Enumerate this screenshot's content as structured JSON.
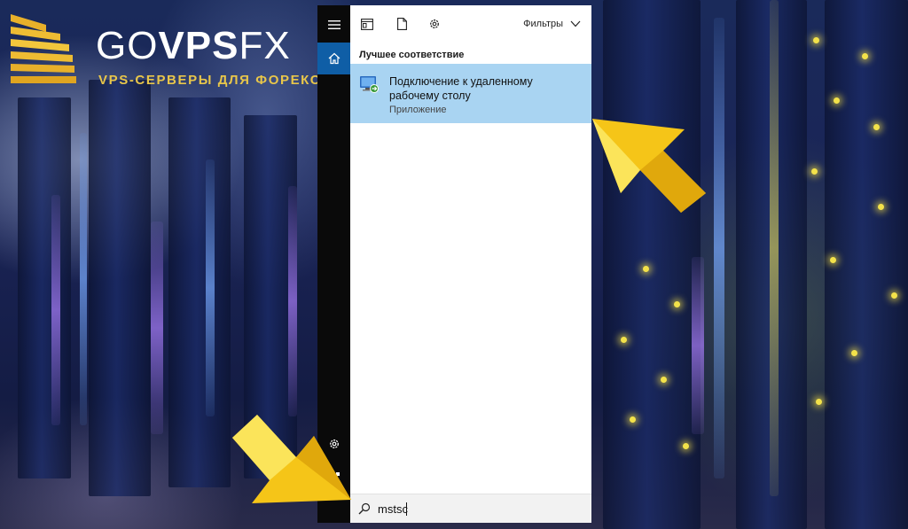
{
  "logo": {
    "go": "GO",
    "vps": "VPS",
    "fx": "FX",
    "tagline": "VPS-СЕРВЕРЫ ДЛЯ ФОРЕКС"
  },
  "start_rail": {
    "items": [
      {
        "icon": "hamburger-menu-icon"
      },
      {
        "icon": "home-icon"
      },
      {
        "icon": "gear-icon"
      },
      {
        "icon": "feedback-icon"
      }
    ]
  },
  "toolbar": {
    "icons": [
      "apps-icon",
      "document-icon",
      "settings-icon"
    ],
    "filters_label": "Фильтры"
  },
  "results": {
    "section_title": "Лучшее соответствие",
    "best_match": {
      "title": "Подключение к удаленному рабочему столу",
      "subtitle": "Приложение",
      "icon": "remote-desktop-icon"
    }
  },
  "search": {
    "value": "mstsc"
  },
  "colors": {
    "accent": "#0f5ea6",
    "highlight": "#a9d4f2",
    "arrow": "#f5c518",
    "logo_gold": "#e8c64a"
  }
}
